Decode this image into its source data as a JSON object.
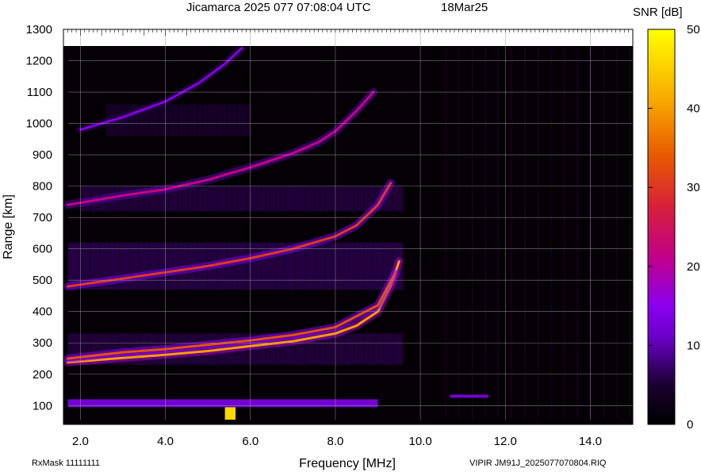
{
  "header": {
    "title": "Jicamarca 2025 077 07:08:04 UTC",
    "date": "18Mar25"
  },
  "footer": {
    "rx_mask": "RxMask 11111111",
    "file": "VIPIR  JM91J_2025077070804.RIQ"
  },
  "chart_data": {
    "type": "heatmap",
    "title": "Jicamarca 2025 077 07:08:04 UTC",
    "xlabel": "Frequency [MHz]",
    "ylabel": "Range [km]",
    "colorbar_label": "SNR [dB]",
    "xlim": [
      1.6,
      15.0
    ],
    "ylim": [
      40,
      1300
    ],
    "zlim": [
      0,
      50
    ],
    "x_ticks": [
      2.0,
      4.0,
      6.0,
      8.0,
      10.0,
      12.0,
      14.0
    ],
    "x_tick_labels": [
      "2.0",
      "4.0",
      "6.0",
      "8.0",
      "10.0",
      "12.0",
      "14.0"
    ],
    "y_ticks": [
      100,
      200,
      300,
      400,
      500,
      600,
      700,
      800,
      900,
      1000,
      1100,
      1200,
      1300
    ],
    "y_tick_labels": [
      "100",
      "200",
      "300",
      "400",
      "500",
      "600",
      "700",
      "800",
      "900",
      "1000",
      "1100",
      "1200",
      "1300"
    ],
    "colorbar_ticks": [
      0,
      10,
      20,
      30,
      40,
      50
    ],
    "colorbar_tick_labels": [
      "0",
      "10",
      "20",
      "30",
      "40",
      "50"
    ],
    "grid": true,
    "colormap": "black-purple-red-orange-yellow",
    "traces": [
      {
        "points": [
          [
            1.7,
            238
          ],
          [
            3.0,
            252
          ],
          [
            4.0,
            262
          ],
          [
            5.0,
            274
          ],
          [
            6.0,
            290
          ],
          [
            7.0,
            305
          ],
          [
            8.0,
            330
          ],
          [
            8.5,
            355
          ],
          [
            9.0,
            400
          ],
          [
            9.3,
            480
          ],
          [
            9.5,
            560
          ]
        ],
        "snr_db": 40
      },
      {
        "points": [
          [
            1.7,
            250
          ],
          [
            3.0,
            270
          ],
          [
            4.0,
            280
          ],
          [
            5.0,
            294
          ],
          [
            6.0,
            308
          ],
          [
            7.0,
            325
          ],
          [
            8.0,
            350
          ],
          [
            9.0,
            420
          ],
          [
            9.4,
            520
          ]
        ],
        "snr_db": 33
      },
      {
        "points": [
          [
            1.7,
            480
          ],
          [
            3.0,
            505
          ],
          [
            4.0,
            525
          ],
          [
            5.0,
            545
          ],
          [
            6.0,
            570
          ],
          [
            7.0,
            600
          ],
          [
            8.0,
            640
          ],
          [
            8.5,
            675
          ],
          [
            9.0,
            740
          ],
          [
            9.3,
            810
          ]
        ],
        "snr_db": 30
      },
      {
        "points": [
          [
            1.7,
            740
          ],
          [
            3.0,
            770
          ],
          [
            4.0,
            790
          ],
          [
            5.0,
            820
          ],
          [
            6.0,
            860
          ],
          [
            7.0,
            905
          ],
          [
            7.6,
            940
          ],
          [
            8.0,
            975
          ],
          [
            8.5,
            1040
          ],
          [
            8.9,
            1100
          ]
        ],
        "snr_db": 22
      },
      {
        "points": [
          [
            2.0,
            980
          ],
          [
            3.0,
            1020
          ],
          [
            4.0,
            1070
          ],
          [
            4.8,
            1130
          ],
          [
            5.4,
            1190
          ],
          [
            5.8,
            1240
          ]
        ],
        "snr_db": 14
      }
    ],
    "patches": [
      {
        "f": [
          5.4,
          5.65
        ],
        "range": [
          55,
          95
        ],
        "snr_db": 46
      },
      {
        "f": [
          1.7,
          9.0
        ],
        "range": [
          95,
          120
        ],
        "snr_db": 12
      },
      {
        "f": [
          10.7,
          11.6
        ],
        "range": [
          125,
          135
        ],
        "snr_db": 12
      }
    ]
  }
}
